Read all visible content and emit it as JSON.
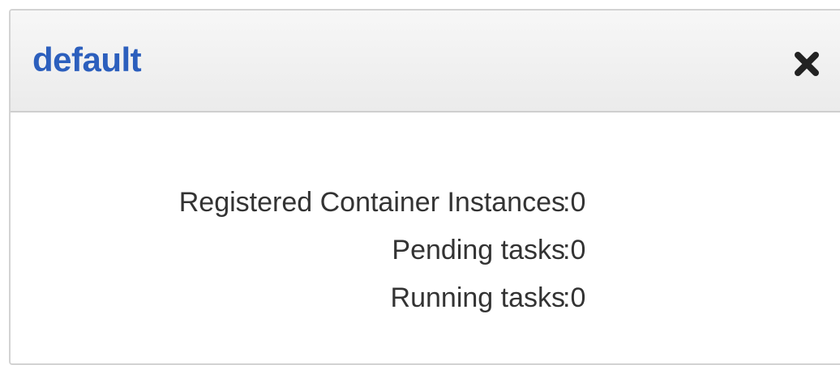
{
  "panel": {
    "title": "default",
    "close_icon": "close-icon"
  },
  "stats": [
    {
      "label": "Registered Container Instances",
      "separator": ":",
      "value": "0"
    },
    {
      "label": "Pending tasks",
      "separator": ":",
      "value": "0"
    },
    {
      "label": "Running tasks",
      "separator": ":",
      "value": "0"
    }
  ],
  "colors": {
    "title": "#2c5fbd",
    "text": "#333333",
    "border": "#d3d3d3"
  }
}
